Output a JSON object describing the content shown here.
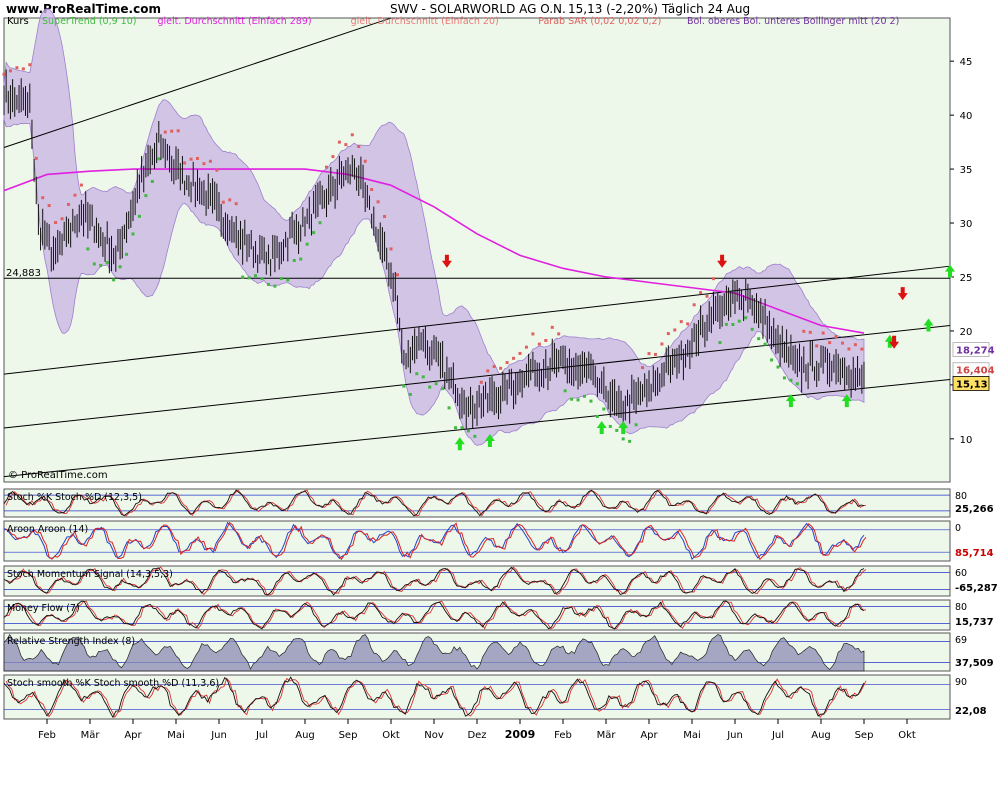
{
  "header": {
    "site": "www.ProRealTime.com",
    "instrument": "SWV - SOLARWORLD AG O.N.",
    "quote": "15,13 (-2,20%)",
    "period": "Täglich  24 Aug"
  },
  "watermark": "© ProRealTime.com",
  "colors": {
    "background": "#eef8ea",
    "supertrend": "#41b841",
    "sma289": "#e020e0",
    "sma20": "#e87878",
    "sar": "#e06060",
    "bollinger": "#9f7fd0",
    "up_arrow": "#22dd22",
    "down_arrow": "#dd1111"
  },
  "chart_data": [
    {
      "type": "candlestick",
      "panel": "price",
      "panel_label": "Kurs",
      "legend": [
        {
          "name": "SuperTrend (0,9 10)",
          "color": "#41b841"
        },
        {
          "name": "gleit. Durchschnitt (Einfach 289)",
          "color": "#e020e0"
        },
        {
          "name": "gleit. Durchschnitt (Einfach 20)",
          "color": "#e87878"
        },
        {
          "name": "Parab SAR (0,02 0,02 0,2)",
          "color": "#e06060"
        },
        {
          "name": "Bol. oberes Bol. unteres Bollinger mitt (20 2)",
          "color": "#7030a0"
        }
      ],
      "ylim": [
        6,
        49
      ],
      "yticks": [
        10,
        15,
        20,
        25,
        30,
        35,
        40,
        45
      ],
      "ytick_labels": [
        "10",
        "15",
        "20",
        "25",
        "30",
        "35",
        "40",
        "45"
      ],
      "hline": {
        "value": 24.883,
        "label": "24,883"
      },
      "price_path": [
        [
          0,
          42
        ],
        [
          0.6,
          41
        ],
        [
          0.8,
          30
        ],
        [
          1.2,
          27
        ],
        [
          1.8,
          31
        ],
        [
          2.2,
          29
        ],
        [
          2.6,
          27
        ],
        [
          3.1,
          33
        ],
        [
          3.6,
          37.5
        ],
        [
          4.2,
          34
        ],
        [
          4.6,
          33
        ],
        [
          5.0,
          31
        ],
        [
          5.6,
          28
        ],
        [
          6.2,
          26.5
        ],
        [
          6.7,
          29
        ],
        [
          7.2,
          31
        ],
        [
          7.8,
          34
        ],
        [
          8.2,
          35
        ],
        [
          8.6,
          30
        ],
        [
          9.1,
          24
        ],
        [
          9.3,
          17
        ],
        [
          9.7,
          19.5
        ],
        [
          10.3,
          16
        ],
        [
          10.8,
          13
        ],
        [
          11.5,
          14
        ],
        [
          12.2,
          16
        ],
        [
          12.8,
          17
        ],
        [
          13.6,
          16
        ],
        [
          14.3,
          13
        ],
        [
          15.0,
          14.5
        ],
        [
          15.8,
          18
        ],
        [
          16.6,
          22
        ],
        [
          17.3,
          23.5
        ],
        [
          17.8,
          20
        ],
        [
          18.5,
          16.5
        ],
        [
          19.2,
          17
        ],
        [
          19.8,
          16
        ],
        [
          20.0,
          15.13
        ]
      ],
      "series": [
        {
          "name": "gleit. Durchschnitt (Einfach 289)",
          "values": [
            [
              0,
              33
            ],
            [
              1,
              34.5
            ],
            [
              2,
              34.8
            ],
            [
              3,
              35
            ],
            [
              4,
              35
            ],
            [
              5,
              35
            ],
            [
              6,
              35
            ],
            [
              7,
              35
            ],
            [
              8,
              34.5
            ],
            [
              9,
              33.5
            ],
            [
              10,
              31.5
            ],
            [
              11,
              29
            ],
            [
              12,
              27
            ],
            [
              13,
              25.8
            ],
            [
              14,
              25
            ],
            [
              15,
              24.5
            ],
            [
              16,
              24
            ],
            [
              17,
              23.5
            ],
            [
              18,
              22
            ],
            [
              19,
              20.5
            ],
            [
              20,
              19.8
            ]
          ]
        }
      ],
      "trend_lines": [
        [
          [
            0,
            37
          ],
          [
            9.0,
            49
          ]
        ],
        [
          [
            0,
            16
          ],
          [
            22,
            26
          ]
        ],
        [
          [
            0,
            11
          ],
          [
            22,
            20.5
          ]
        ],
        [
          [
            0,
            6.5
          ],
          [
            22,
            15.5
          ]
        ]
      ],
      "up_signals": [
        [
          10.6,
          9.5
        ],
        [
          11.3,
          9.8
        ],
        [
          13.9,
          11
        ],
        [
          14.4,
          11
        ],
        [
          18.3,
          13.5
        ],
        [
          19.6,
          13.5
        ],
        [
          20.6,
          19
        ],
        [
          21.5,
          20.5
        ],
        [
          22.0,
          25.5
        ]
      ],
      "down_signals": [
        [
          10.3,
          26.5
        ],
        [
          16.7,
          26.5
        ],
        [
          20.9,
          23.5
        ],
        [
          20.7,
          19
        ]
      ],
      "last_value_labels": [
        {
          "value": 18.274,
          "label": "18,274",
          "color": "#7030a0"
        },
        {
          "value": 16.404,
          "label": "16,404",
          "color": "#cc4444"
        },
        {
          "value": 15.13,
          "label": "15,13",
          "color": "#000000",
          "highlight": true
        }
      ]
    },
    {
      "type": "line",
      "panel": "stoch",
      "panel_label": "Stoch %K Stoch %D (12,3,5)",
      "ylim": [
        0,
        100
      ],
      "levels": [
        20,
        80
      ],
      "ytick_labels": [
        "80"
      ],
      "last_value": "25,266"
    },
    {
      "type": "line",
      "panel": "aroon",
      "panel_label": "Aroon Aroon (14)",
      "ylim": [
        0,
        100
      ],
      "ytick_labels": [
        "0"
      ],
      "last_value": "85,714"
    },
    {
      "type": "line",
      "panel": "stoch-momentum",
      "panel_label": "Stoch Momentum Signal (14,3,5,3)",
      "ylim": [
        -100,
        100
      ],
      "ytick_labels": [
        "60"
      ],
      "last_value": "-65,287"
    },
    {
      "type": "line",
      "panel": "money-flow",
      "panel_label": "Money Flow (7)",
      "ylim": [
        0,
        100
      ],
      "ytick_labels": [
        "80"
      ],
      "last_value": "15,737"
    },
    {
      "type": "area",
      "panel": "rsi",
      "panel_label": "Relative Strength Index (8)",
      "ylim": [
        0,
        100
      ],
      "ytick_labels": [
        "69"
      ],
      "last_value": "37,509"
    },
    {
      "type": "line",
      "panel": "stoch-smooth",
      "panel_label": "Stoch smooth %K Stoch smooth %D (11,3,6)",
      "ylim": [
        0,
        100
      ],
      "ytick_labels": [
        "90"
      ],
      "last_value": "22,08"
    }
  ],
  "x_axis": {
    "labels": [
      "Feb",
      "Mär",
      "Apr",
      "Mai",
      "Jun",
      "Jul",
      "Aug",
      "Sep",
      "Okt",
      "Nov",
      "Dez",
      "2009",
      "Feb",
      "Mär",
      "Apr",
      "Mai",
      "Jun",
      "Jul",
      "Aug",
      "Sep",
      "Okt"
    ],
    "bold_index": 11
  }
}
